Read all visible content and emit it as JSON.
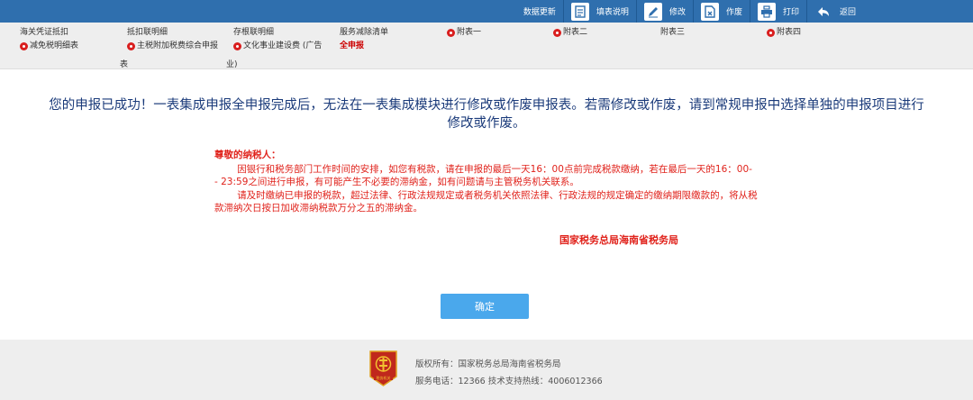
{
  "toolbar": {
    "data_update": "数据更新",
    "fill_guide": "填表说明",
    "modify": "修改",
    "void": "作废",
    "print": "打印",
    "back": "返回"
  },
  "tabs": [
    {
      "label": "海关凭证抵扣",
      "marked": false
    },
    {
      "label": "抵扣联明细",
      "marked": false
    },
    {
      "label": "存根联明细",
      "marked": false
    },
    {
      "label": "服务减除清单",
      "marked": false
    },
    {
      "label": "附表一",
      "marked": true
    },
    {
      "label": "附表二",
      "marked": true
    },
    {
      "label": "附表三",
      "marked": false
    },
    {
      "label": "附表四",
      "marked": true
    },
    {
      "label": "减免税明细表",
      "marked": true
    },
    {
      "label": "主税附加税费综合申报",
      "cont": "表",
      "marked": true
    },
    {
      "label": "文化事业建设费 (广告",
      "cont": "业)",
      "marked": true
    },
    {
      "label": "全申报",
      "marked": false,
      "active": true
    }
  ],
  "message": {
    "line1": "您的申报已成功！一表集成申报全申报完成后，无法在一表集成模块进行修改或作废申报表。若需修改或作废，请到常规申报中选择单独的申报项目进行",
    "line2": "修改或作废。"
  },
  "notice": {
    "title": "尊敬的纳税人：",
    "para1": "因银行和税务部门工作时间的安排，如您有税款，请在申报的最后一天16：00点前完成税款缴纳，若在最后一天的16：00- - 23:59之间进行申报，有可能产生不必要的滞纳金，如有问题请与主管税务机关联系。",
    "para2": "请及时缴纳已申报的税款，超过法律、行政法规规定或者税务机关依照法律、行政法规的规定确定的缴纳期限缴款的，将从税款滞纳次日按日加收滞纳税款万分之五的滞纳金。",
    "signature": "国家税务总局海南省税务局"
  },
  "confirm_label": "确定",
  "footer": {
    "copyright": "版权所有：国家税务总局海南省税务局",
    "phone": "服务电话：12366 技术支持热线：4006012366",
    "logo_text": "税务机关"
  }
}
